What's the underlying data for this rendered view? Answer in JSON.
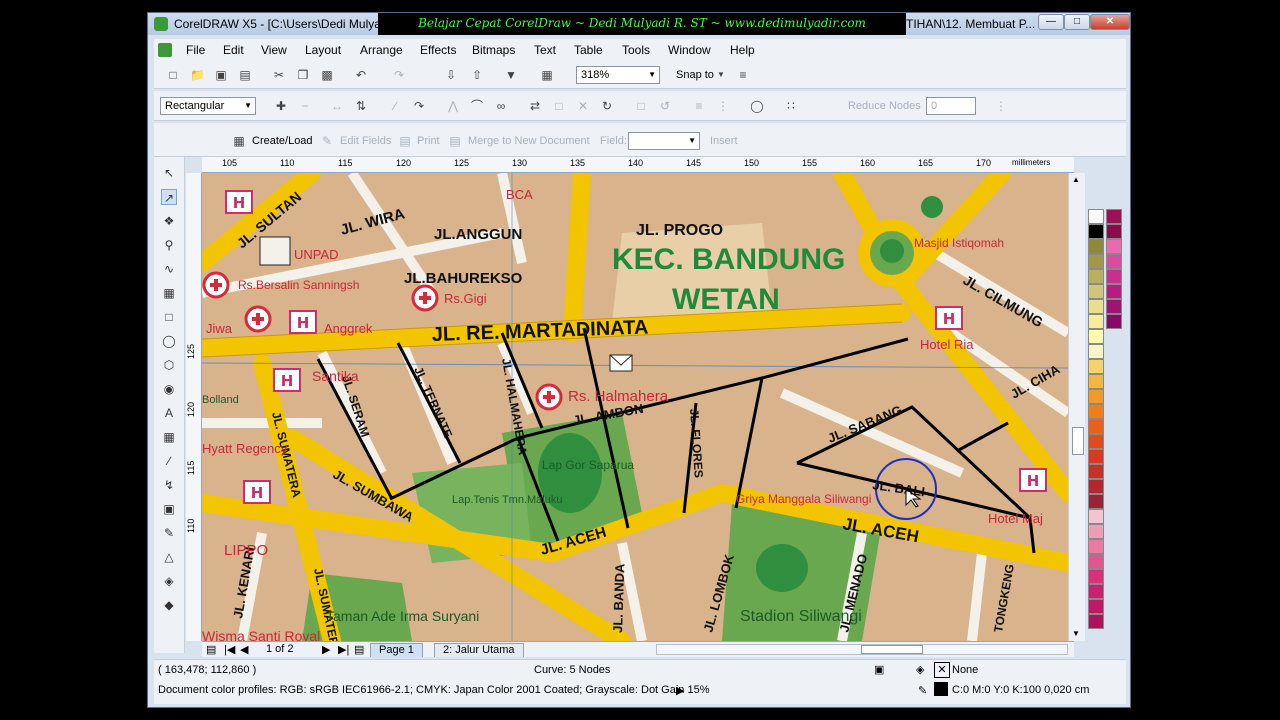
{
  "window": {
    "title": "CorelDRAW X5 - [C:\\Users\\Dedi Mulya",
    "title_tail": "TIHAN\\12. Membuat P...",
    "banner": "Belajar Cepat CorelDraw ~ Dedi Mulyadi R. ST ~ www.dedimulyadir.com",
    "banner_color": "#3dff3d"
  },
  "menu": [
    "File",
    "Edit",
    "View",
    "Layout",
    "Arrange",
    "Effects",
    "Bitmaps",
    "Text",
    "Table",
    "Tools",
    "Window",
    "Help"
  ],
  "toolbar": {
    "zoom": "318%",
    "snap_to": "Snap to"
  },
  "property_bar": {
    "selection_mode": "Rectangular",
    "reduce_nodes_label": "Reduce Nodes",
    "reduce_nodes_value": "0"
  },
  "merge_bar": {
    "create_load": "Create/Load",
    "edit_fields": "Edit Fields",
    "print": "Print",
    "merge_to_new": "Merge to New Document",
    "field_label": "Field:",
    "insert": "Insert"
  },
  "ruler": {
    "top_ticks": [
      "105",
      "110",
      "115",
      "120",
      "125",
      "130",
      "135",
      "140",
      "145",
      "150",
      "155",
      "160",
      "165",
      "170"
    ],
    "left_ticks": [
      "125",
      "120",
      "115",
      "110"
    ],
    "unit": "millimeters"
  },
  "map": {
    "district": [
      "KEC. BANDUNG",
      "WETAN"
    ],
    "streets": [
      "JL. SULTAN",
      "JL. WIRA",
      "JL.ANGGUN",
      "JL. PROGO",
      "JL.BAHUREKSO",
      "JL. RE. MARTADINATA",
      "JL. CILMUNG",
      "JL. SERAM",
      "JL. TERNATE",
      "JL. AMBON",
      "JL. FLORES",
      "JL. SABANG",
      "JL. SUMATERA",
      "JL. SUMBAWA",
      "JL. ACEH",
      "JL. ACEH",
      "JL. BANDA",
      "JL. LOMBOK",
      "JL. MENADO",
      "JL. KENARI",
      "JL. SUMATERA",
      "JL. BALI",
      "TONGKENG",
      "JL. CIHA",
      "JL. HALMAHERA"
    ],
    "places": [
      "UNPAD",
      "Rs.Bersalin Sanningsh",
      "Rs.Gigi",
      "Anggrek",
      "Hyatt Regency",
      "Rs. Halmahera",
      "Lap Gor Saparua",
      "Lap.Tenis Tmn.Maluku",
      "Masjid Istiqomah",
      "Hotel Ria",
      "Griya Manggala Siliwangi",
      "Stadion Siliwangi",
      "Taman Ade Irma Suryani",
      "Wisma Santi Royal",
      "LIPPO",
      "Santika",
      "Jiwa",
      "BCA",
      "Hotel Maj",
      "Bolland",
      "Siliwangi"
    ]
  },
  "page_bar": {
    "counter": "1 of 2",
    "tabs": [
      "Page 1",
      "2: Jalur Utama"
    ]
  },
  "status": {
    "coords": "( 163,478; 112,860 )",
    "curve": "Curve: 5 Nodes",
    "fill": "None",
    "outline": "C:0 M:0 Y:0 K:100  0,020 cm",
    "profiles": "Document color profiles: RGB: sRGB IEC61966-2.1; CMYK: Japan Color 2001 Coated; Grayscale: Dot Gain 15%"
  },
  "palette": [
    "#ffffff",
    "#000000",
    "#8f8a3a",
    "#a0994a",
    "#b7b060",
    "#cfc67a",
    "#e8e08f",
    "#f4ee9e",
    "#fffbb0",
    "#f8f3c8",
    "#f6d36a",
    "#f3b640",
    "#f09a2a",
    "#ee7d1a",
    "#e8601a",
    "#e04a1f",
    "#d63a22",
    "#c82e2a",
    "#b22830",
    "#9a2335",
    "#f1c4d0",
    "#ee9fb8",
    "#e97aa2",
    "#e2548d",
    "#d9307a",
    "#cc1f6f",
    "#bd1966",
    "#ae145d",
    "#9c1055",
    "#8a0c4c",
    "#e86ab0",
    "#d84da0",
    "#c83090",
    "#b81c82",
    "#a01274",
    "#880a66"
  ]
}
